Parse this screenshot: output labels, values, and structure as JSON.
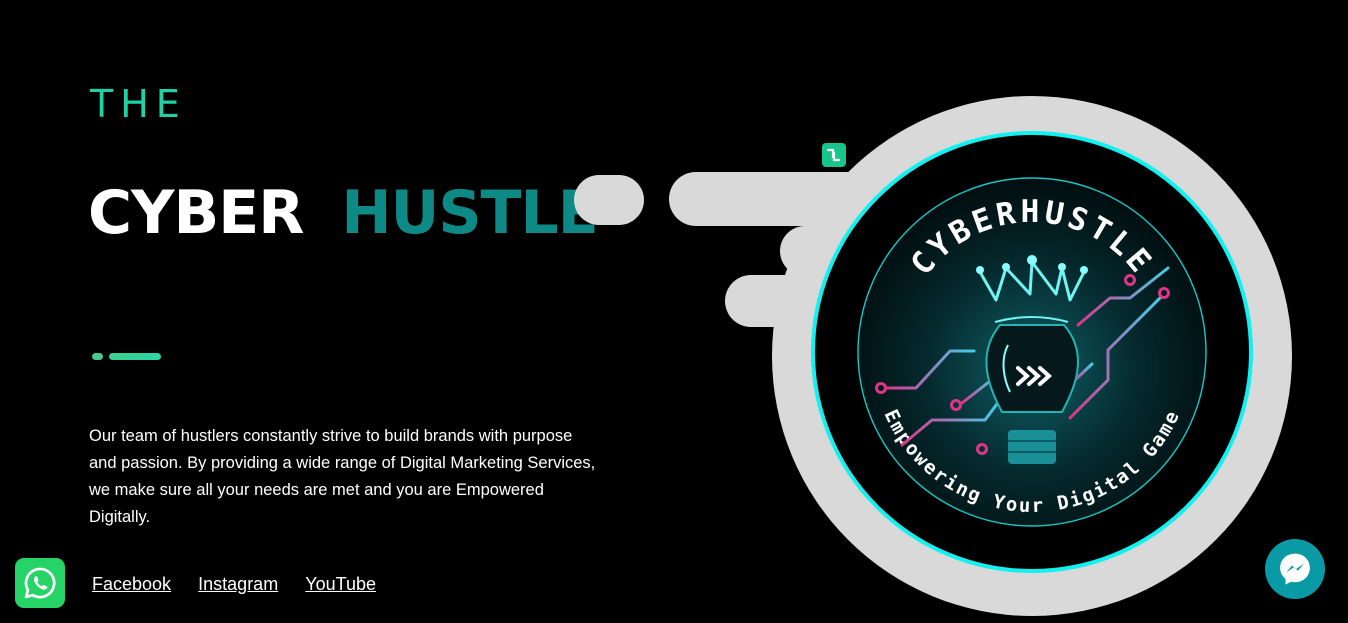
{
  "hero": {
    "kicker": "THE",
    "title_part1": "CYBER",
    "title_part2": "HUSTLE",
    "description": "Our team of hustlers constantly strive to build brands with purpose and passion. By providing a wide range of Digital Marketing Services, we make sure all your needs are met and you are Empowered Digitally."
  },
  "social_links": [
    {
      "label": "Facebook"
    },
    {
      "label": "Instagram"
    },
    {
      "label": "YouTube"
    }
  ],
  "logo": {
    "top_text": "CYBERHUSTLE",
    "bottom_text": "Empowering Your Digital Game",
    "icon": "lightbulb-crown-icon"
  },
  "floating_buttons": {
    "whatsapp_icon": "whatsapp-icon",
    "messenger_icon": "messenger-icon"
  },
  "colors": {
    "background": "#000000",
    "kicker": "#1fd1a4",
    "title_accent": "#0d8a86",
    "ring_cyan": "#12f0f0",
    "pill_gray": "#d9d9d9",
    "whatsapp_green": "#25d366",
    "messenger_teal": "#0a9aa6"
  }
}
